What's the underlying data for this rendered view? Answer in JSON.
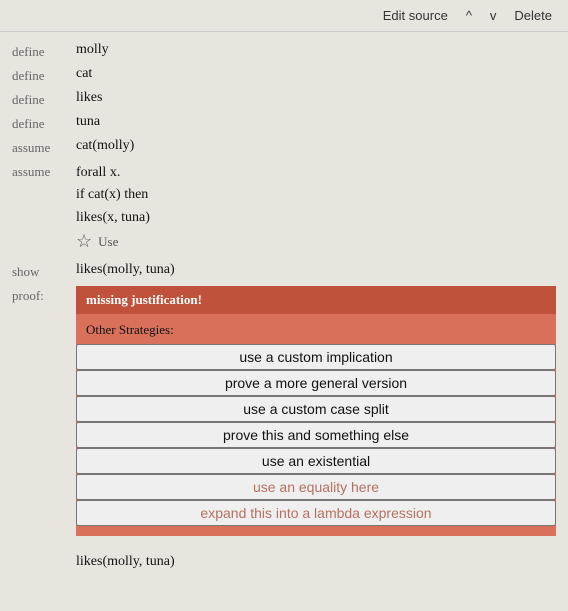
{
  "topbar": {
    "edit_source": "Edit source",
    "up": "^",
    "down": "v",
    "delete": "Delete"
  },
  "rows": [
    {
      "keyword": "define",
      "expr": "molly"
    },
    {
      "keyword": "define",
      "expr": "cat"
    },
    {
      "keyword": "define",
      "expr": "likes"
    },
    {
      "keyword": "define",
      "expr": "tuna"
    }
  ],
  "assume1": {
    "keyword": "assume",
    "expr": "cat(molly)"
  },
  "assume2": {
    "keyword": "assume",
    "lines": [
      "forall x.",
      "if cat(x) then",
      "likes(x, tuna)"
    ],
    "use_label": "Use"
  },
  "show": {
    "keyword": "show",
    "expr": "likes(molly, tuna)"
  },
  "proof": {
    "keyword": "proof:",
    "missing": "missing justification!",
    "other_strategies_label": "Other Strategies:",
    "strategies": [
      {
        "label": "use a custom implication",
        "disabled": false
      },
      {
        "label": "prove a more general version",
        "disabled": false
      },
      {
        "label": "use a custom case split",
        "disabled": false
      },
      {
        "label": "prove this and something else",
        "disabled": false
      },
      {
        "label": "use an existential",
        "disabled": false
      },
      {
        "label": "use an equality here",
        "disabled": true
      },
      {
        "label": "expand this into a lambda expression",
        "disabled": true
      }
    ]
  },
  "bottom_expr": "likes(molly, tuna)"
}
